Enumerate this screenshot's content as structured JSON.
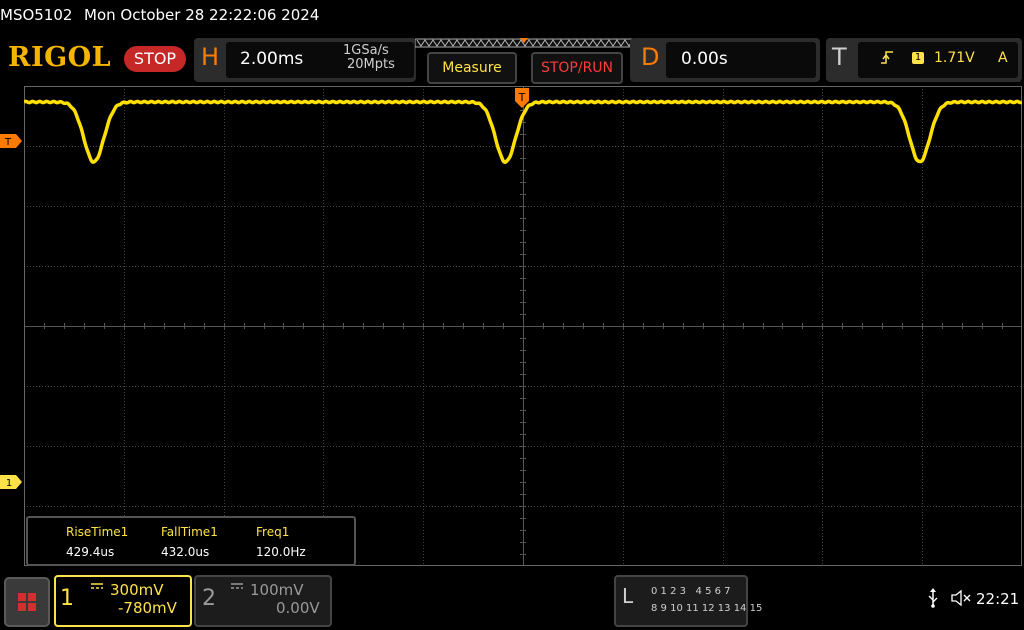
{
  "title": {
    "model": "MSO5102",
    "datetime": "Mon October 28 22:22:06 2024"
  },
  "toolbar": {
    "logo": "RIGOL",
    "run_state": "STOP",
    "horizontal": {
      "letter": "H",
      "timebase": "2.00ms",
      "sample_rate": "1GSa/s",
      "memory_depth": "20Mpts"
    },
    "measure_label": "Measure",
    "stoprun_label": "STOP/RUN",
    "delay": {
      "letter": "D",
      "value": "0.00s"
    },
    "trigger": {
      "letter": "T",
      "slope_icon": "rising-edge-icon",
      "source": "1",
      "level": "1.71V",
      "mode": "A"
    }
  },
  "screen": {
    "trigger_marker_top": "T",
    "trigger_marker_left": "T",
    "channel1_marker": "1",
    "waveform": {
      "color": "#ffe000",
      "dips": [
        {
          "time_ms": -8.6,
          "depth_v": 0.3
        },
        {
          "time_ms": -0.35,
          "depth_v": 0.3
        },
        {
          "time_ms": 7.95,
          "depth_v": 0.3
        }
      ]
    }
  },
  "measurements": [
    {
      "name": "RiseTime1",
      "value": "429.4us"
    },
    {
      "name": "FallTime1",
      "value": "432.0us"
    },
    {
      "name": "Freq1",
      "value": "120.0Hz"
    }
  ],
  "channels": [
    {
      "number": "1",
      "coupling_icon": "dc-coupling-icon",
      "scale": "300mV",
      "offset": "-780mV",
      "color": "#ffe24a",
      "active": true
    },
    {
      "number": "2",
      "coupling_icon": "dc-coupling-icon",
      "scale": "100mV",
      "offset": "0.00V",
      "color": "#9a9a9a",
      "active": false
    }
  ],
  "logic_analyzer": {
    "letter": "L",
    "row1": "0 1 2 3   4 5 6 7",
    "row2": "8 9 10 11 12 13 14 15"
  },
  "status": {
    "usb_icon": "usb-icon",
    "sound_icon": "speaker-muted-icon",
    "clock": "22:21"
  }
}
